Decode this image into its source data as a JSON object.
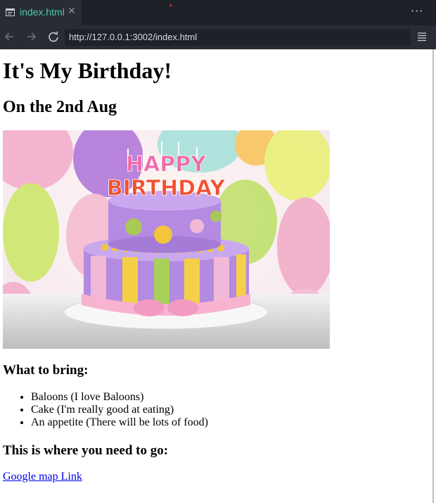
{
  "browser": {
    "tab_title": "index.html",
    "tab_close": "✕",
    "more_menu": "···",
    "url": "http://127.0.0.1:3002/index.html"
  },
  "page": {
    "title": "It's My Birthday!",
    "date_heading": "On the 2nd Aug",
    "bring_heading": "What to bring:",
    "bring_items": [
      "Baloons (I love Baloons)",
      "Cake (I'm really good at eating)",
      "An appetite (There will be lots of food)"
    ],
    "where_heading": "This is where you need to go:",
    "map_link": "Google map Link",
    "cake_topper": "HAPPY BIRTHDAY"
  },
  "colors": {
    "tab_text": "#4ec9a9",
    "chrome_dark": "#1e2127",
    "chrome": "#282c34",
    "link": "#0000ee"
  },
  "icons": [
    "page-icon",
    "close-icon",
    "more-icon",
    "back-arrow-icon",
    "forward-arrow-icon",
    "reload-icon",
    "menu-icon"
  ]
}
